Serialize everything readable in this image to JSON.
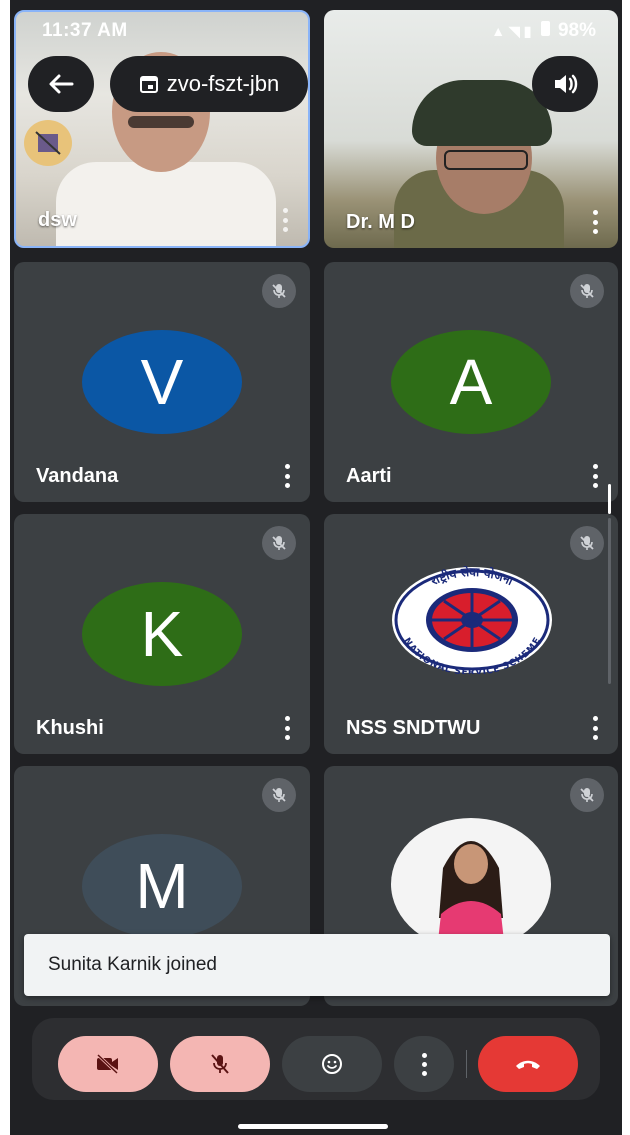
{
  "status_bar": {
    "time": "11:37 AM",
    "battery": "98%"
  },
  "meeting": {
    "code": "zvo-fszt-jbn"
  },
  "video_tiles": [
    {
      "name": "dsw"
    },
    {
      "name": "Dr. M D"
    }
  ],
  "participants": [
    {
      "name": "Vandana",
      "initial": "V",
      "color": "#0b57a5"
    },
    {
      "name": "Aarti",
      "initial": "A",
      "color": "#2e6d17"
    },
    {
      "name": "Khushi",
      "initial": "K",
      "color": "#2e6d17"
    },
    {
      "name": "NSS SNDTWU"
    },
    {
      "initial": "M",
      "color": "#3f4d59"
    },
    {}
  ],
  "nss_logo": {
    "top_text": "राष्ट्रीय सेवा योजना",
    "bottom_text": "NATIONAL SERVICE SCHEME"
  },
  "toast": {
    "message": "Sunita Karnik joined"
  },
  "colors": {
    "background": "#202124",
    "tile": "#3c4043",
    "control_off": "#f4b6b3",
    "end_call": "#e53935"
  }
}
